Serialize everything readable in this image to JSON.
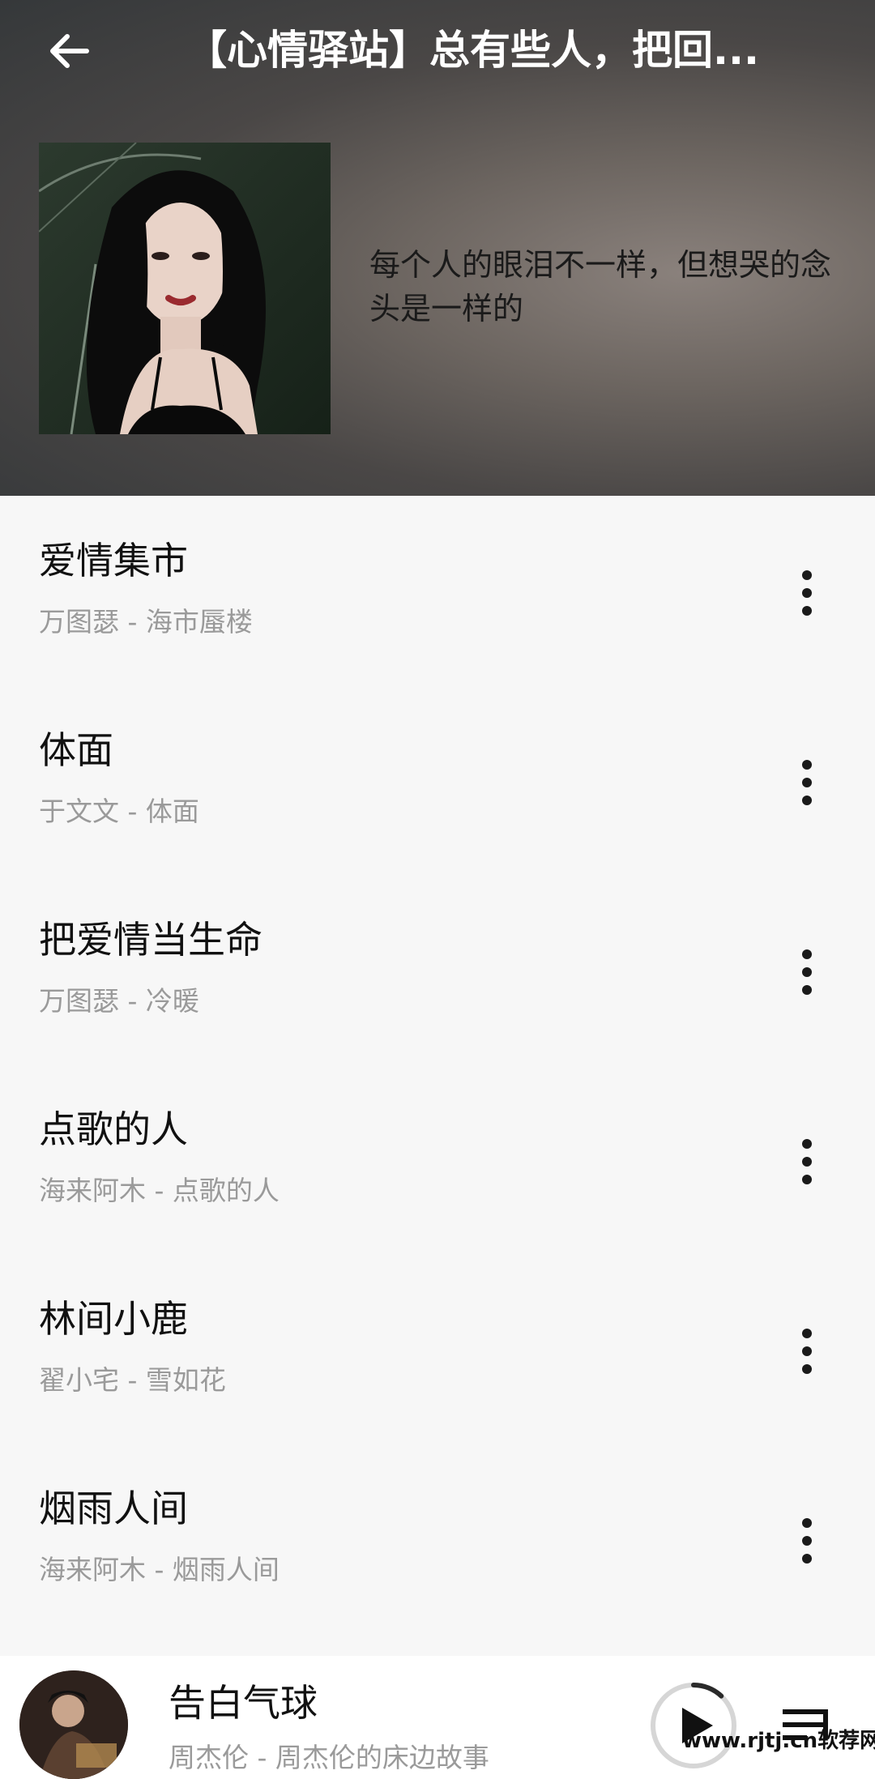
{
  "header": {
    "title": "【心情驿站】总有些人，把回...",
    "description": "每个人的眼泪不一样，但想哭的念头是一样的"
  },
  "songs": [
    {
      "title": "爱情集市",
      "subtitle": "万图瑟 - 海市蜃楼"
    },
    {
      "title": "体面",
      "subtitle": "于文文 - 体面"
    },
    {
      "title": "把爱情当生命",
      "subtitle": "万图瑟 - 冷暖"
    },
    {
      "title": "点歌的人",
      "subtitle": "海来阿木 - 点歌的人"
    },
    {
      "title": "林间小鹿",
      "subtitle": "翟小宅 - 雪如花"
    },
    {
      "title": "烟雨人间",
      "subtitle": "海来阿木 - 烟雨人间"
    }
  ],
  "now_playing": {
    "title": "告白气球",
    "subtitle": "周杰伦 - 周杰伦的床边故事",
    "progress": 0.12
  },
  "watermark": "www.rjtj.cn软荐网",
  "icons": {
    "back": "arrow-left-icon",
    "more": "more-vertical-icon",
    "play": "play-icon",
    "queue": "playlist-icon"
  }
}
